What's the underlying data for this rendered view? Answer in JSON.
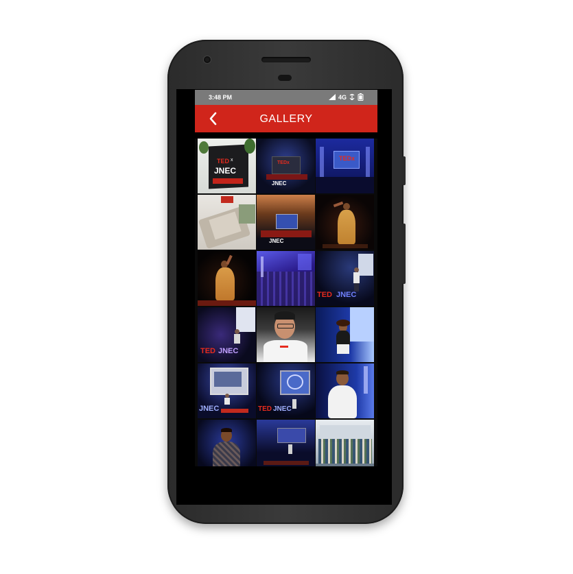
{
  "status_bar": {
    "time": "3:48 PM",
    "network": "4G",
    "icons": [
      "signal-icon",
      "network-type",
      "wifi-calling-icon",
      "battery-icon"
    ]
  },
  "app_bar": {
    "title": "GALLERY",
    "back_icon": "chevron-left-icon"
  },
  "colors": {
    "app_bar_bg": "#d0251b",
    "status_bar_bg": "#7a7a7a",
    "screen_bg": "#000000",
    "phone_body": "#2b2b2b",
    "ted_red": "#e62b1e"
  },
  "gallery": {
    "columns": 3,
    "photo_count": 18,
    "photos": [
      {
        "id": "photo-1",
        "scene": "welcome-board",
        "caption": "JNEC"
      },
      {
        "id": "photo-2",
        "scene": "stage-screen",
        "caption": "JNEC"
      },
      {
        "id": "photo-3",
        "scene": "stage-wide-blue",
        "caption": ""
      },
      {
        "id": "photo-4",
        "scene": "venue-model",
        "caption": ""
      },
      {
        "id": "photo-5",
        "scene": "auditorium-stage",
        "caption": "JNEC"
      },
      {
        "id": "photo-6",
        "scene": "dancer-saree",
        "caption": ""
      },
      {
        "id": "photo-7",
        "scene": "dancer-saree-2",
        "caption": ""
      },
      {
        "id": "photo-8",
        "scene": "audience-purple",
        "caption": ""
      },
      {
        "id": "photo-9",
        "scene": "speaker-stage",
        "caption": "JNEC"
      },
      {
        "id": "photo-10",
        "scene": "speaker-slide",
        "caption": "JNEC"
      },
      {
        "id": "photo-11",
        "scene": "portrait-smiling",
        "caption": ""
      },
      {
        "id": "photo-12",
        "scene": "speaker-woman",
        "caption": ""
      },
      {
        "id": "photo-13",
        "scene": "speaker-screen",
        "caption": "JNEC"
      },
      {
        "id": "photo-14",
        "scene": "stage-screen-2",
        "caption": "JNEC"
      },
      {
        "id": "photo-15",
        "scene": "speaker-man-white",
        "caption": ""
      },
      {
        "id": "photo-16",
        "scene": "speaker-checked-shirt",
        "caption": ""
      },
      {
        "id": "photo-17",
        "scene": "stage-dark",
        "caption": ""
      },
      {
        "id": "photo-18",
        "scene": "group-photo",
        "caption": ""
      }
    ]
  }
}
